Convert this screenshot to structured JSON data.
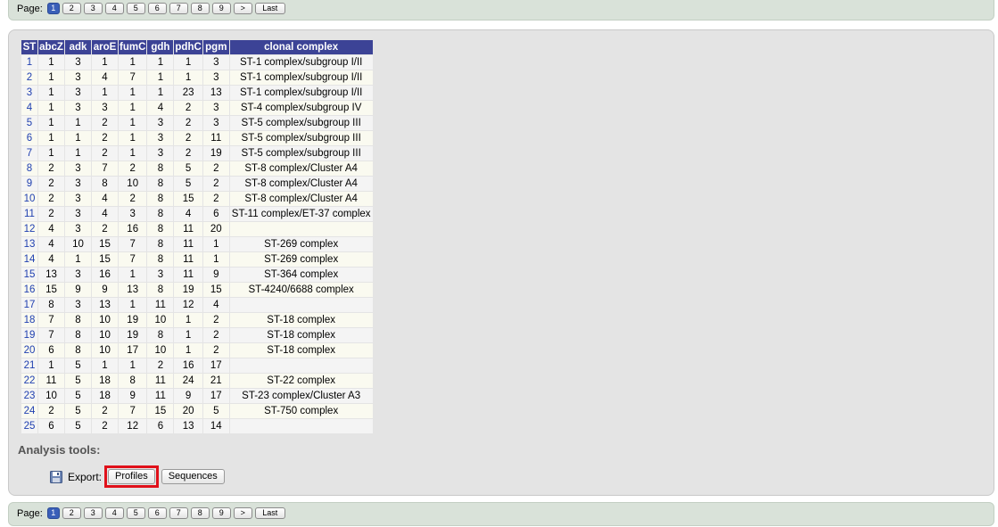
{
  "pager": {
    "label": "Page:",
    "pages": [
      "1",
      "2",
      "3",
      "4",
      "5",
      "6",
      "7",
      "8",
      "9"
    ],
    "current": "1",
    "next_label": ">",
    "last_label": "Last"
  },
  "table": {
    "headers": [
      "ST",
      "abcZ",
      "adk",
      "aroE",
      "fumC",
      "gdh",
      "pdhC",
      "pgm",
      "clonal complex"
    ],
    "rows": [
      [
        "1",
        "1",
        "3",
        "1",
        "1",
        "1",
        "1",
        "3",
        "ST-1 complex/subgroup I/II"
      ],
      [
        "2",
        "1",
        "3",
        "4",
        "7",
        "1",
        "1",
        "3",
        "ST-1 complex/subgroup I/II"
      ],
      [
        "3",
        "1",
        "3",
        "1",
        "1",
        "1",
        "23",
        "13",
        "ST-1 complex/subgroup I/II"
      ],
      [
        "4",
        "1",
        "3",
        "3",
        "1",
        "4",
        "2",
        "3",
        "ST-4 complex/subgroup IV"
      ],
      [
        "5",
        "1",
        "1",
        "2",
        "1",
        "3",
        "2",
        "3",
        "ST-5 complex/subgroup III"
      ],
      [
        "6",
        "1",
        "1",
        "2",
        "1",
        "3",
        "2",
        "11",
        "ST-5 complex/subgroup III"
      ],
      [
        "7",
        "1",
        "1",
        "2",
        "1",
        "3",
        "2",
        "19",
        "ST-5 complex/subgroup III"
      ],
      [
        "8",
        "2",
        "3",
        "7",
        "2",
        "8",
        "5",
        "2",
        "ST-8 complex/Cluster A4"
      ],
      [
        "9",
        "2",
        "3",
        "8",
        "10",
        "8",
        "5",
        "2",
        "ST-8 complex/Cluster A4"
      ],
      [
        "10",
        "2",
        "3",
        "4",
        "2",
        "8",
        "15",
        "2",
        "ST-8 complex/Cluster A4"
      ],
      [
        "11",
        "2",
        "3",
        "4",
        "3",
        "8",
        "4",
        "6",
        "ST-11 complex/ET-37 complex"
      ],
      [
        "12",
        "4",
        "3",
        "2",
        "16",
        "8",
        "11",
        "20",
        ""
      ],
      [
        "13",
        "4",
        "10",
        "15",
        "7",
        "8",
        "11",
        "1",
        "ST-269 complex"
      ],
      [
        "14",
        "4",
        "1",
        "15",
        "7",
        "8",
        "11",
        "1",
        "ST-269 complex"
      ],
      [
        "15",
        "13",
        "3",
        "16",
        "1",
        "3",
        "11",
        "9",
        "ST-364 complex"
      ],
      [
        "16",
        "15",
        "9",
        "9",
        "13",
        "8",
        "19",
        "15",
        "ST-4240/6688 complex"
      ],
      [
        "17",
        "8",
        "3",
        "13",
        "1",
        "11",
        "12",
        "4",
        ""
      ],
      [
        "18",
        "7",
        "8",
        "10",
        "19",
        "10",
        "1",
        "2",
        "ST-18 complex"
      ],
      [
        "19",
        "7",
        "8",
        "10",
        "19",
        "8",
        "1",
        "2",
        "ST-18 complex"
      ],
      [
        "20",
        "6",
        "8",
        "10",
        "17",
        "10",
        "1",
        "2",
        "ST-18 complex"
      ],
      [
        "21",
        "1",
        "5",
        "1",
        "1",
        "2",
        "16",
        "17",
        ""
      ],
      [
        "22",
        "11",
        "5",
        "18",
        "8",
        "11",
        "24",
        "21",
        "ST-22 complex"
      ],
      [
        "23",
        "10",
        "5",
        "18",
        "9",
        "11",
        "9",
        "17",
        "ST-23 complex/Cluster A3"
      ],
      [
        "24",
        "2",
        "5",
        "2",
        "7",
        "15",
        "20",
        "5",
        "ST-750 complex"
      ],
      [
        "25",
        "6",
        "5",
        "2",
        "12",
        "6",
        "13",
        "14",
        ""
      ]
    ]
  },
  "analysis": {
    "heading": "Analysis tools:",
    "export_label": "Export:",
    "profiles_label": "Profiles",
    "sequences_label": "Sequences",
    "icon": "save-icon"
  },
  "colors": {
    "header_bg": "#3c4396",
    "link": "#2040b0",
    "highlight": "#e0101a",
    "current_page": "#3a5fb8"
  }
}
